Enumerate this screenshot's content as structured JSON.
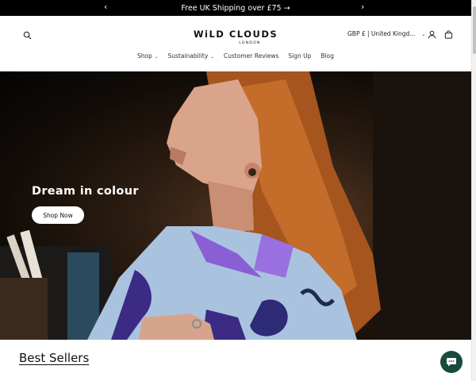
{
  "announcement": {
    "text": "Free UK Shipping over £75 →",
    "prev_icon": "chevron-left-icon",
    "next_icon": "chevron-right-icon"
  },
  "header": {
    "logo_text": "WiLD CLOUDS",
    "logo_subtext": "LONDON",
    "currency_label": "GBP £ | United Kingd...",
    "icons": {
      "search": "search-icon",
      "account": "user-icon",
      "cart": "bag-icon"
    }
  },
  "nav": {
    "items": [
      {
        "label": "Shop"
      },
      {
        "label": "Sustainability"
      },
      {
        "label": "Customer Reviews"
      },
      {
        "label": "Sign Up"
      },
      {
        "label": "Blog"
      }
    ]
  },
  "hero": {
    "title": "Dream in colour",
    "button_label": "Shop Now"
  },
  "best_sellers": {
    "heading": "Best Sellers"
  },
  "chat": {
    "icon": "chat-bubble-icon",
    "color": "#184a3e"
  },
  "colors": {
    "announcement_bg": "#000000",
    "hero_button_bg": "#ffffff"
  }
}
